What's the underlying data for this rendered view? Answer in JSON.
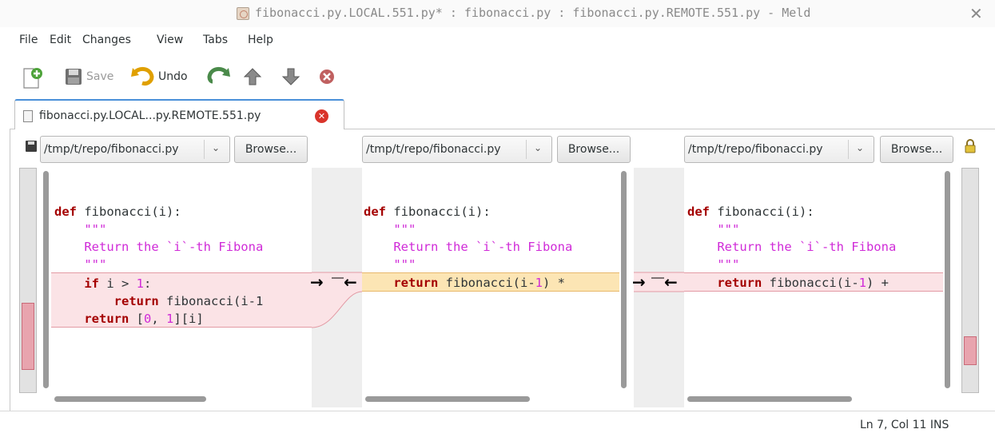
{
  "window": {
    "title": "fibonacci.py.LOCAL.551.py* : fibonacci.py : fibonacci.py.REMOTE.551.py - Meld",
    "close_glyph": "✕"
  },
  "menu": [
    "File",
    "Edit",
    "Changes",
    "View",
    "Tabs",
    "Help"
  ],
  "toolbar": {
    "save_label": "Save",
    "undo_label": "Undo",
    "icons": [
      "new-comparison-icon",
      "save-icon",
      "undo-icon",
      "redo-icon",
      "previous-change-icon",
      "next-change-icon",
      "stop-icon"
    ]
  },
  "tab": {
    "label": "fibonacci.py.LOCAL...py.REMOTE.551.py",
    "close_glyph": "✕"
  },
  "panes": [
    {
      "path": "/tmp/t/repo/fibonacci.py",
      "browse_label": "Browse..."
    },
    {
      "path": "/tmp/t/repo/fibonacci.py",
      "browse_label": "Browse..."
    },
    {
      "path": "/tmp/t/repo/fibonacci.py",
      "browse_label": "Browse..."
    }
  ],
  "code": {
    "left": [
      {
        "kind": "def",
        "text": "fibonacci(i):"
      },
      {
        "kind": "doc",
        "text": "\"\"\""
      },
      {
        "kind": "doc",
        "text": "Return the `i`-th Fibona"
      },
      {
        "kind": "doc",
        "text": "\"\"\""
      },
      {
        "kind": "chunk-if",
        "text": "i > ",
        "num": "1",
        "tail": ":"
      },
      {
        "kind": "chunk-ret",
        "text": "fibonacci(i-1"
      },
      {
        "kind": "chunk-list",
        "text": "[",
        "n0": "0",
        "sep": ", ",
        "n1": "1",
        "tail": "][i]"
      }
    ],
    "middle": [
      {
        "kind": "def",
        "text": "fibonacci(i):"
      },
      {
        "kind": "doc",
        "text": "\"\"\""
      },
      {
        "kind": "doc",
        "text": "Return the `i`-th Fibona"
      },
      {
        "kind": "doc",
        "text": "\"\"\""
      },
      {
        "kind": "chunk-ret",
        "text": "fibonacci(i-",
        "num": "1",
        "tail": ") *"
      }
    ],
    "right": [
      {
        "kind": "def",
        "text": "fibonacci(i):"
      },
      {
        "kind": "doc",
        "text": "\"\"\""
      },
      {
        "kind": "doc",
        "text": "Return the `i`-th Fibona"
      },
      {
        "kind": "doc",
        "text": "\"\"\""
      },
      {
        "kind": "chunk-ret",
        "text": "fibonacci(i-",
        "num": "1",
        "tail": ") +"
      }
    ],
    "keywords": {
      "def": "def",
      "if": "if",
      "return": "return"
    }
  },
  "colors": {
    "deleted_chunk": "#fbe3e6",
    "changed_chunk": "#fce5b4",
    "keyword": "#a40000",
    "docstring": "#d02bd8"
  },
  "status": {
    "text": "Ln 7, Col 11  INS"
  }
}
